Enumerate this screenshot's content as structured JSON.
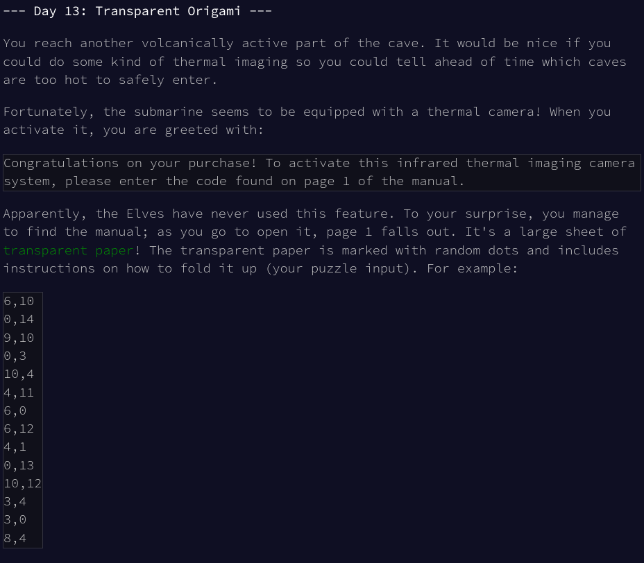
{
  "title": "--- Day 13: Transparent Origami ---",
  "para1": "You reach another volcanically active part of the cave. It would be nice if you could do some kind of thermal imaging so you could tell ahead of time which caves are too hot to safely enter.",
  "para2": "Fortunately, the submarine seems to be equipped with a thermal camera! When you activate it, you are greeted with:",
  "message": "Congratulations on your purchase! To activate this infrared thermal imaging camera system, please enter the code found on page 1 of the manual.",
  "para3_part1": "Apparently, the Elves have never used this feature. To your surprise, you manage to find the manual; as you go to open it, page 1 falls out. It's a large sheet of ",
  "para3_link": "transparent paper",
  "para3_part2": "! The transparent paper is marked with random dots and includes instructions on how to fold it up (your puzzle input). For example:",
  "example_input": "6,10\n0,14\n9,10\n0,3\n10,4\n4,11\n6,0\n6,12\n4,1\n0,13\n10,12\n3,4\n3,0\n8,4"
}
